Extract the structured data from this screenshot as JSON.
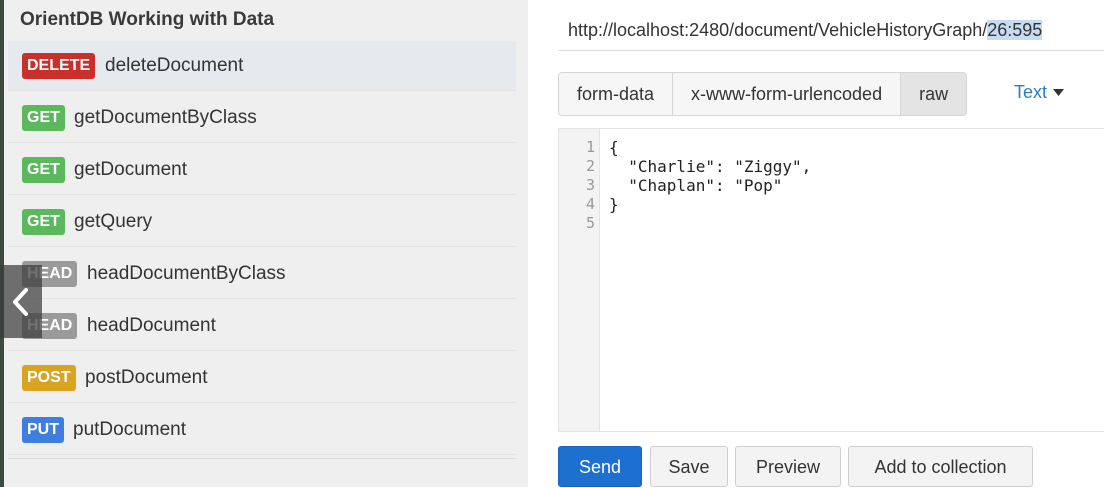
{
  "sidebar": {
    "title": "OrientDB Working with Data",
    "requests": [
      {
        "method": "DELETE",
        "name": "deleteDocument"
      },
      {
        "method": "GET",
        "name": "getDocumentByClass"
      },
      {
        "method": "GET",
        "name": "getDocument"
      },
      {
        "method": "GET",
        "name": "getQuery"
      },
      {
        "method": "HEAD",
        "name": "headDocumentByClass"
      },
      {
        "method": "HEAD",
        "name": "headDocument"
      },
      {
        "method": "POST",
        "name": "postDocument"
      },
      {
        "method": "PUT",
        "name": "putDocument"
      }
    ],
    "collapse_icon": "chevron-left-icon"
  },
  "request": {
    "url_prefix": "http://localhost:2480/document/VehicleHistoryGraph/",
    "url_selected": "26:595"
  },
  "body_tabs": [
    "form-data",
    "x-www-form-urlencoded",
    "raw"
  ],
  "selected_tab": "raw",
  "format_dropdown": "Text",
  "editor": {
    "line_numbers": [
      "1",
      "2",
      "3",
      "4",
      "5"
    ],
    "lines": [
      "{",
      "  \"Charlie\": \"Ziggy\",",
      "  \"Chaplan\": \"Pop\"",
      "}",
      ""
    ]
  },
  "actions": {
    "send": "Send",
    "save": "Save",
    "preview": "Preview",
    "add_to_collection": "Add to collection"
  },
  "colors": {
    "delete": "#c9302c",
    "get": "#5cb85c",
    "head": "#9a9a9a",
    "post": "#d9a421",
    "put": "#3d7ee0",
    "send": "#1d6fd0",
    "link": "#2a7ec0"
  }
}
